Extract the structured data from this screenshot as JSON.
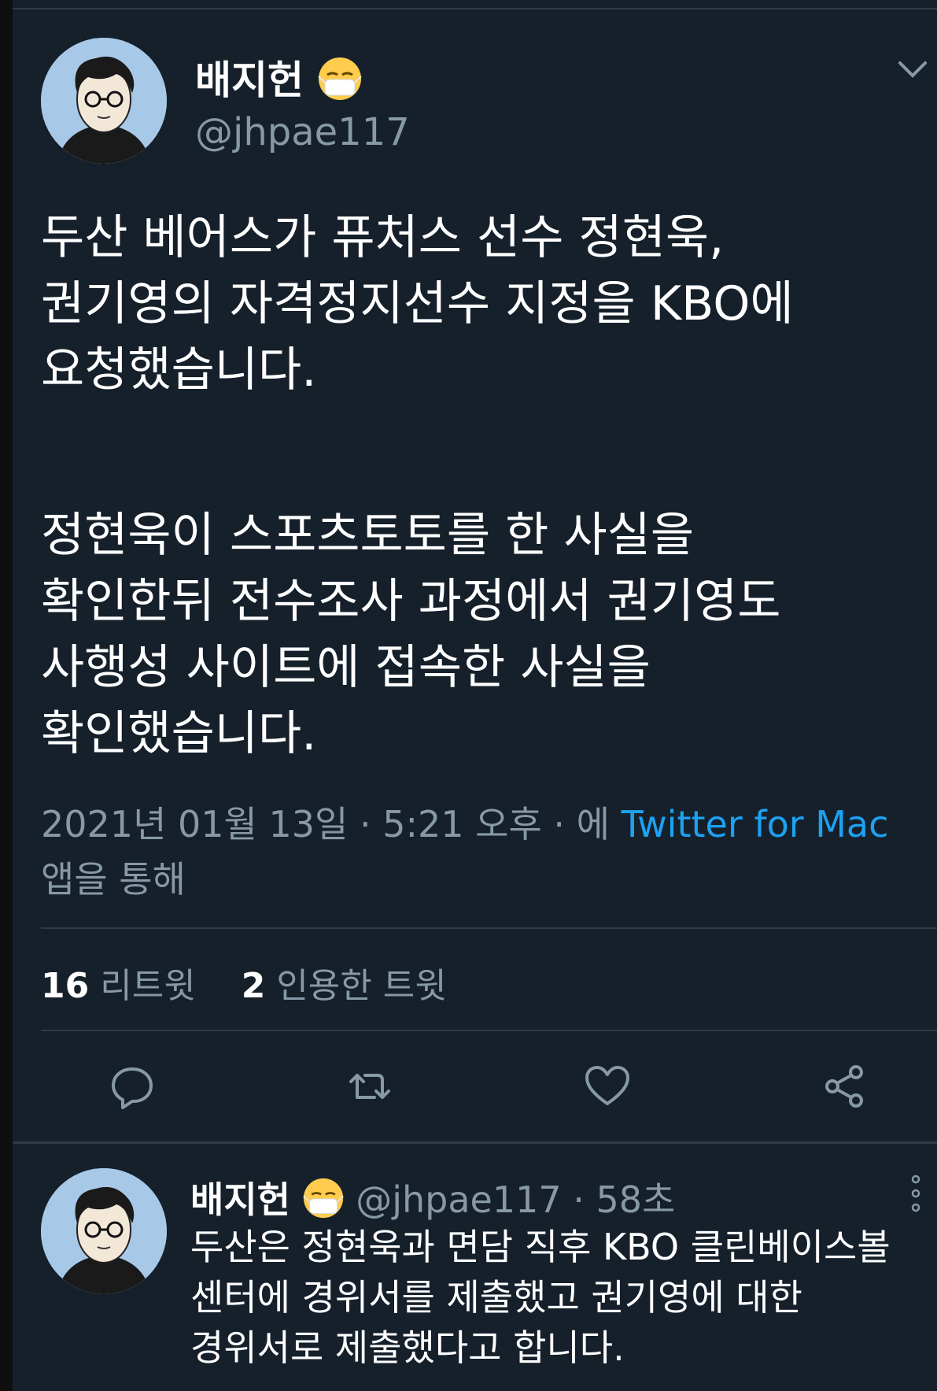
{
  "tweet": {
    "author_name": "배지헌",
    "author_handle": "@jhpae117",
    "text_lines": [
      "두산 베어스가 퓨처스 선수 정현욱,",
      "권기영의 자격정지선수 지정을 KBO에",
      "요청했습니다.",
      "정현욱이 스포츠토토를 한 사실을",
      "확인한뒤 전수조사 과정에서 권기영도",
      "사행성 사이트에 접속한 사실을",
      "확인했습니다."
    ],
    "meta_date": "2021년 01월 13일 · 5:21 오후 · 에 ",
    "meta_source": "Twitter for Mac",
    "meta_suffix": "앱을 통해",
    "retweet_count": "16",
    "retweet_label": "리트윗",
    "quote_count": "2",
    "quote_label": "인용한 트윗"
  },
  "reply": {
    "author_name": "배지헌",
    "author_handle": "@jhpae117",
    "time": "· 58초",
    "text_lines": [
      "두산은 정현욱과 면담 직후 KBO 클린베이스볼",
      "센터에 경위서를 제출했고 권기영에 대한",
      "경위서로 제출했다고 합니다."
    ]
  },
  "icons": {
    "emoji": "face-with-medical-mask-icon",
    "caret": "chevron-down-icon",
    "reply": "reply-icon",
    "retweet": "retweet-icon",
    "like": "heart-icon",
    "share": "share-icon",
    "more": "more-vertical-icon"
  },
  "colors": {
    "background": "#15202b",
    "accent": "#1da1f2",
    "secondary_text": "#8899a6",
    "divider": "#2f3b47"
  }
}
